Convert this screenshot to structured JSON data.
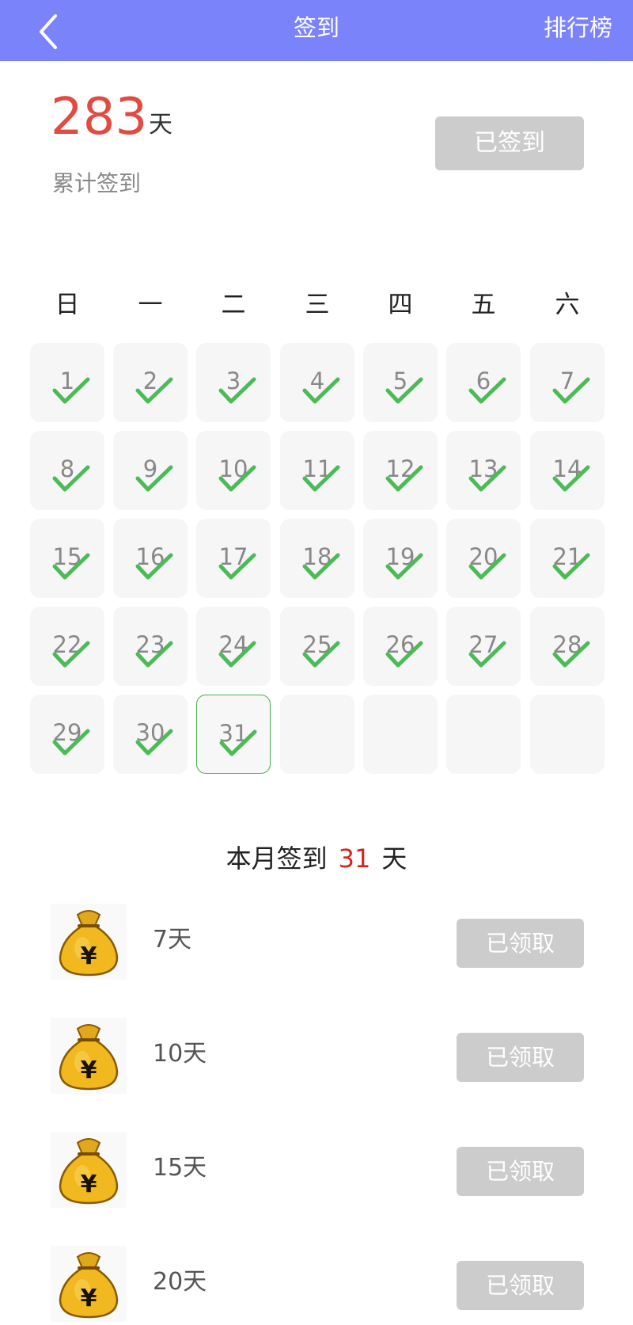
{
  "header": {
    "title": "签到",
    "right_link": "排行榜",
    "accent": "#7b83fb"
  },
  "summary": {
    "total_days": "283",
    "unit": "天",
    "label": "累计签到",
    "sign_button": "已签到"
  },
  "weekdays": [
    "日",
    "一",
    "二",
    "三",
    "四",
    "五",
    "六"
  ],
  "calendar": {
    "days": [
      "1",
      "2",
      "3",
      "4",
      "5",
      "6",
      "7",
      "8",
      "9",
      "10",
      "11",
      "12",
      "13",
      "14",
      "15",
      "16",
      "17",
      "18",
      "19",
      "20",
      "21",
      "22",
      "23",
      "24",
      "25",
      "26",
      "27",
      "28",
      "29",
      "30",
      "31"
    ],
    "today": "31",
    "check_color": "#4cba57"
  },
  "month": {
    "prefix": "本月签到",
    "count": "31",
    "suffix": "天"
  },
  "rewards": [
    {
      "days": "7天",
      "button": "已领取",
      "icon": "money-bag-icon"
    },
    {
      "days": "10天",
      "button": "已领取",
      "icon": "money-bag-icon"
    },
    {
      "days": "15天",
      "button": "已领取",
      "icon": "money-bag-icon"
    },
    {
      "days": "20天",
      "button": "已领取",
      "icon": "money-bag-icon"
    }
  ]
}
